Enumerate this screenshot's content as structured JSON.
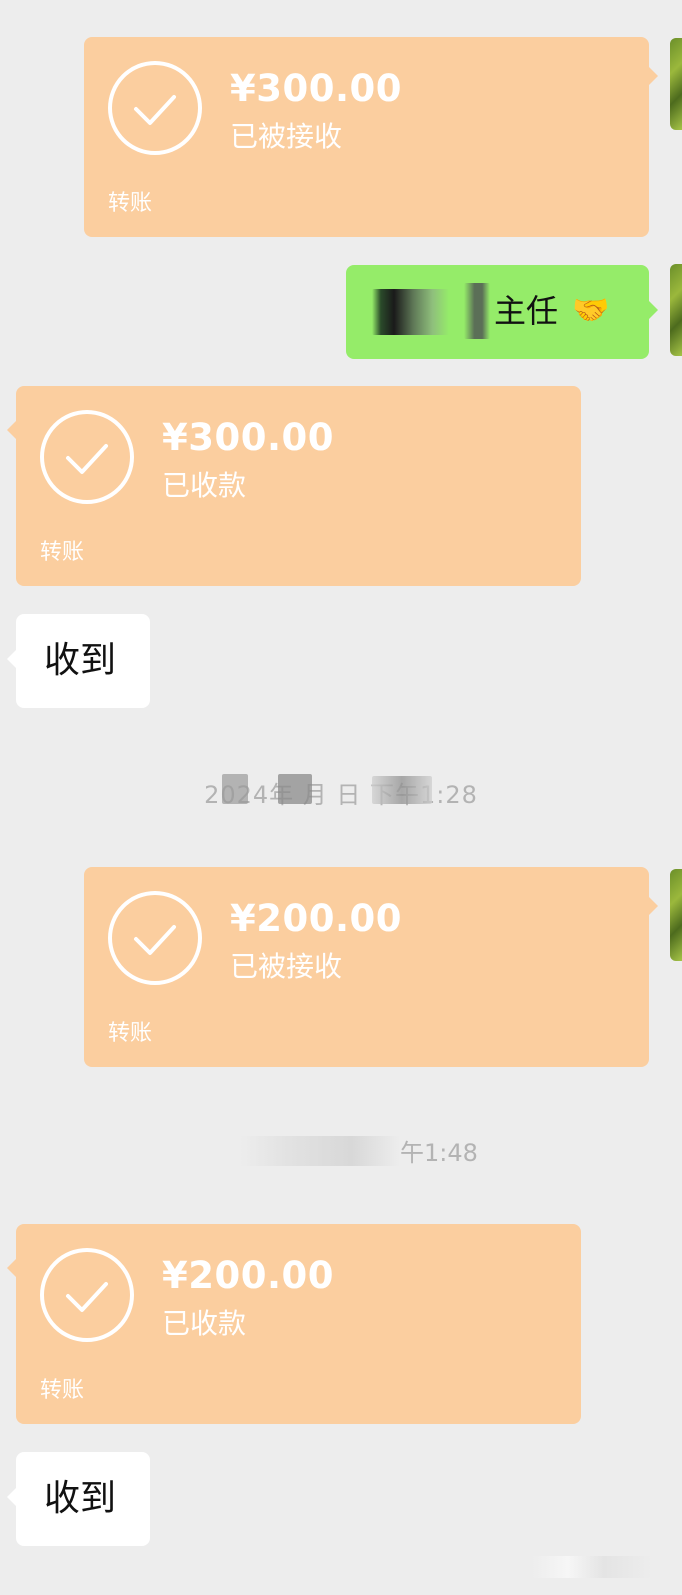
{
  "messages": {
    "m1": {
      "amount": "¥300.00",
      "status": "已被接收",
      "label": "转账"
    },
    "m2": {
      "text": "主任",
      "emoji": "🤝"
    },
    "m3": {
      "amount": "¥300.00",
      "status": "已收款",
      "label": "转账"
    },
    "m4": {
      "text": "收到"
    },
    "ts1": {
      "text": "2024年 月 日 下午1:28"
    },
    "m5": {
      "amount": "¥200.00",
      "status": "已被接收",
      "label": "转账"
    },
    "ts2": {
      "text": "午1:48"
    },
    "m6": {
      "amount": "¥200.00",
      "status": "已收款",
      "label": "转账"
    },
    "m7": {
      "text": "收到"
    }
  },
  "colors": {
    "background": "#ededed",
    "transfer_bubble": "#fbce9f",
    "sent_text_bubble": "#95ec69",
    "received_text_bubble": "#ffffff"
  },
  "icons": {
    "transfer_status": "check-circle-icon",
    "avatar": "avatar-image"
  }
}
